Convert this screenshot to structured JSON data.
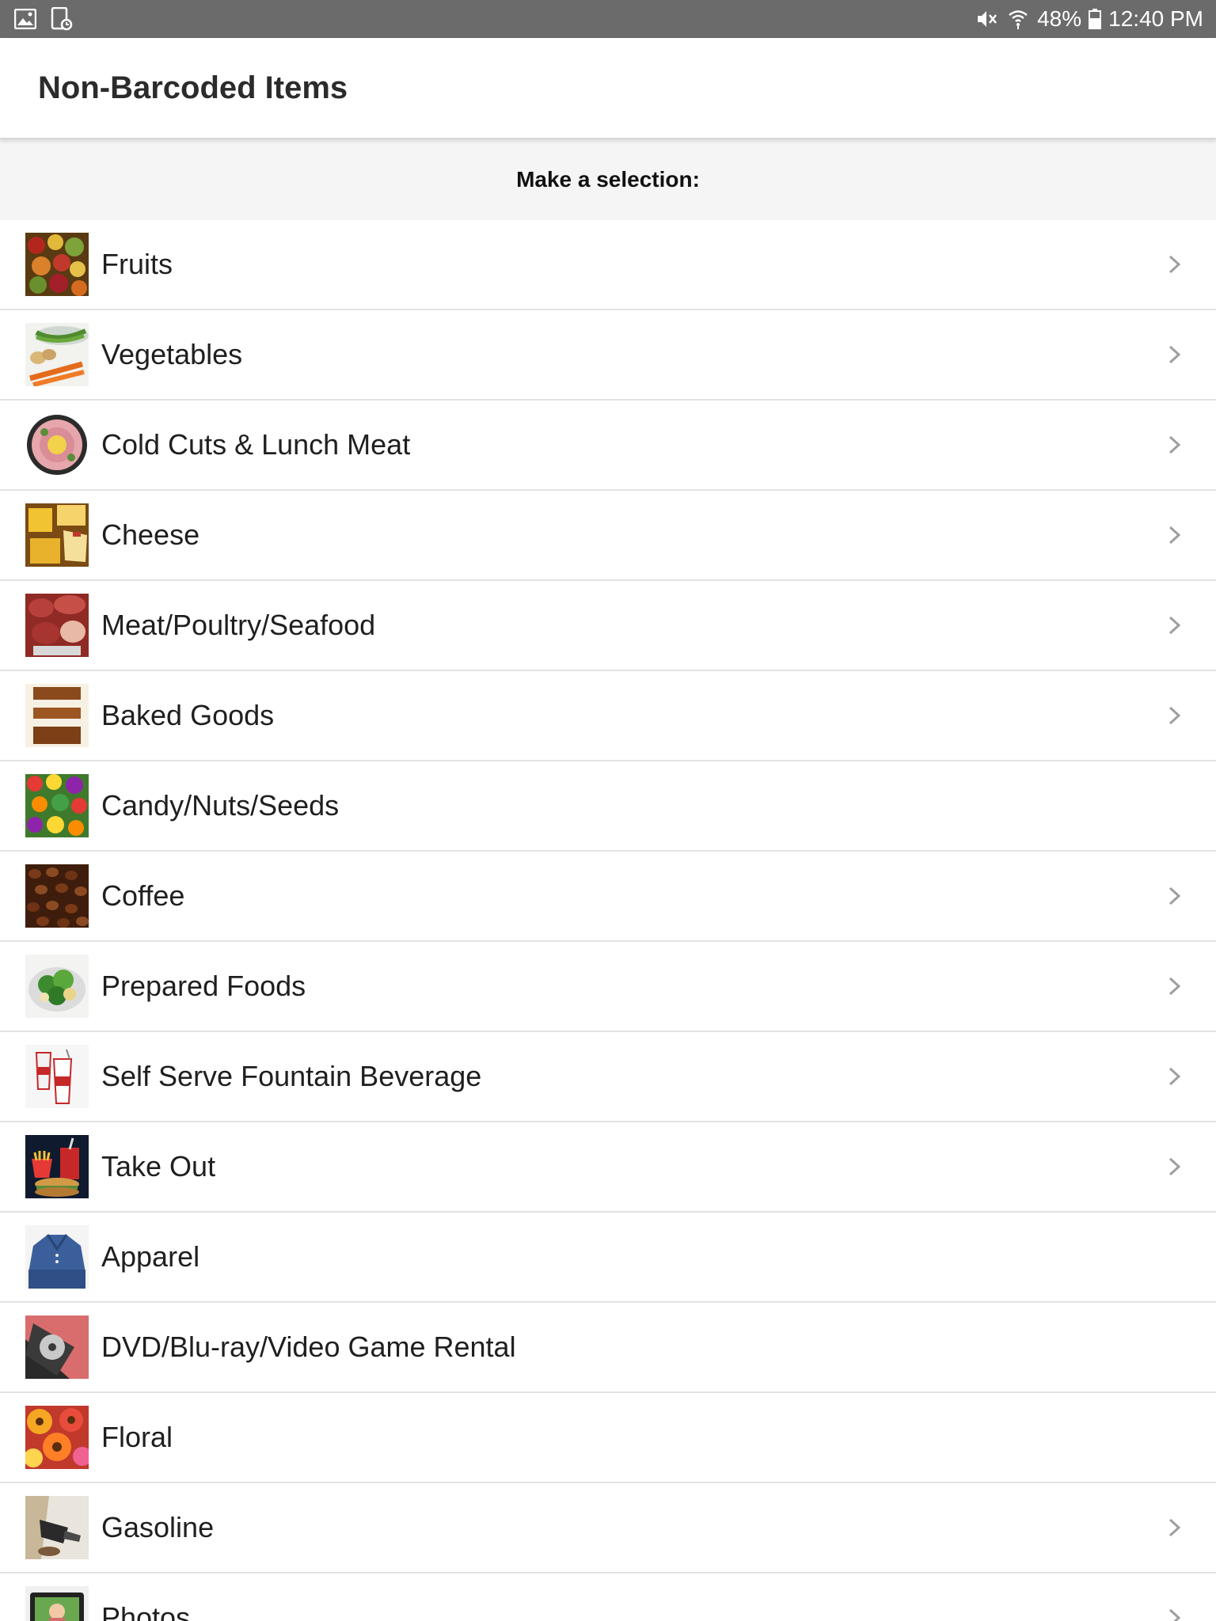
{
  "status_bar": {
    "battery": "48%",
    "time": "12:40 PM",
    "icons": [
      "image-icon",
      "tablet-sync-icon",
      "mute-icon",
      "wifi-icon",
      "battery-icon"
    ]
  },
  "app_bar": {
    "title": "Non-Barcoded Items"
  },
  "selection": {
    "prompt": "Make a selection:"
  },
  "colors": {
    "status_bar_bg": "#6b6b6b",
    "header_bg": "#f5f5f5",
    "divider": "#e3e3e3",
    "chevron": "#9e9e9e"
  },
  "items": [
    {
      "label": "Fruits",
      "has_chevron": true
    },
    {
      "label": "Vegetables",
      "has_chevron": true
    },
    {
      "label": "Cold Cuts & Lunch Meat",
      "has_chevron": true
    },
    {
      "label": "Cheese",
      "has_chevron": true
    },
    {
      "label": "Meat/Poultry/Seafood",
      "has_chevron": true
    },
    {
      "label": "Baked Goods",
      "has_chevron": true
    },
    {
      "label": "Candy/Nuts/Seeds",
      "has_chevron": false
    },
    {
      "label": "Coffee",
      "has_chevron": true
    },
    {
      "label": "Prepared Foods",
      "has_chevron": true
    },
    {
      "label": "Self Serve Fountain Beverage",
      "has_chevron": true
    },
    {
      "label": "Take Out",
      "has_chevron": true
    },
    {
      "label": "Apparel",
      "has_chevron": false
    },
    {
      "label": "DVD/Blu-ray/Video Game Rental",
      "has_chevron": false
    },
    {
      "label": "Floral",
      "has_chevron": false
    },
    {
      "label": "Gasoline",
      "has_chevron": true
    },
    {
      "label": "Photos",
      "has_chevron": true
    }
  ]
}
